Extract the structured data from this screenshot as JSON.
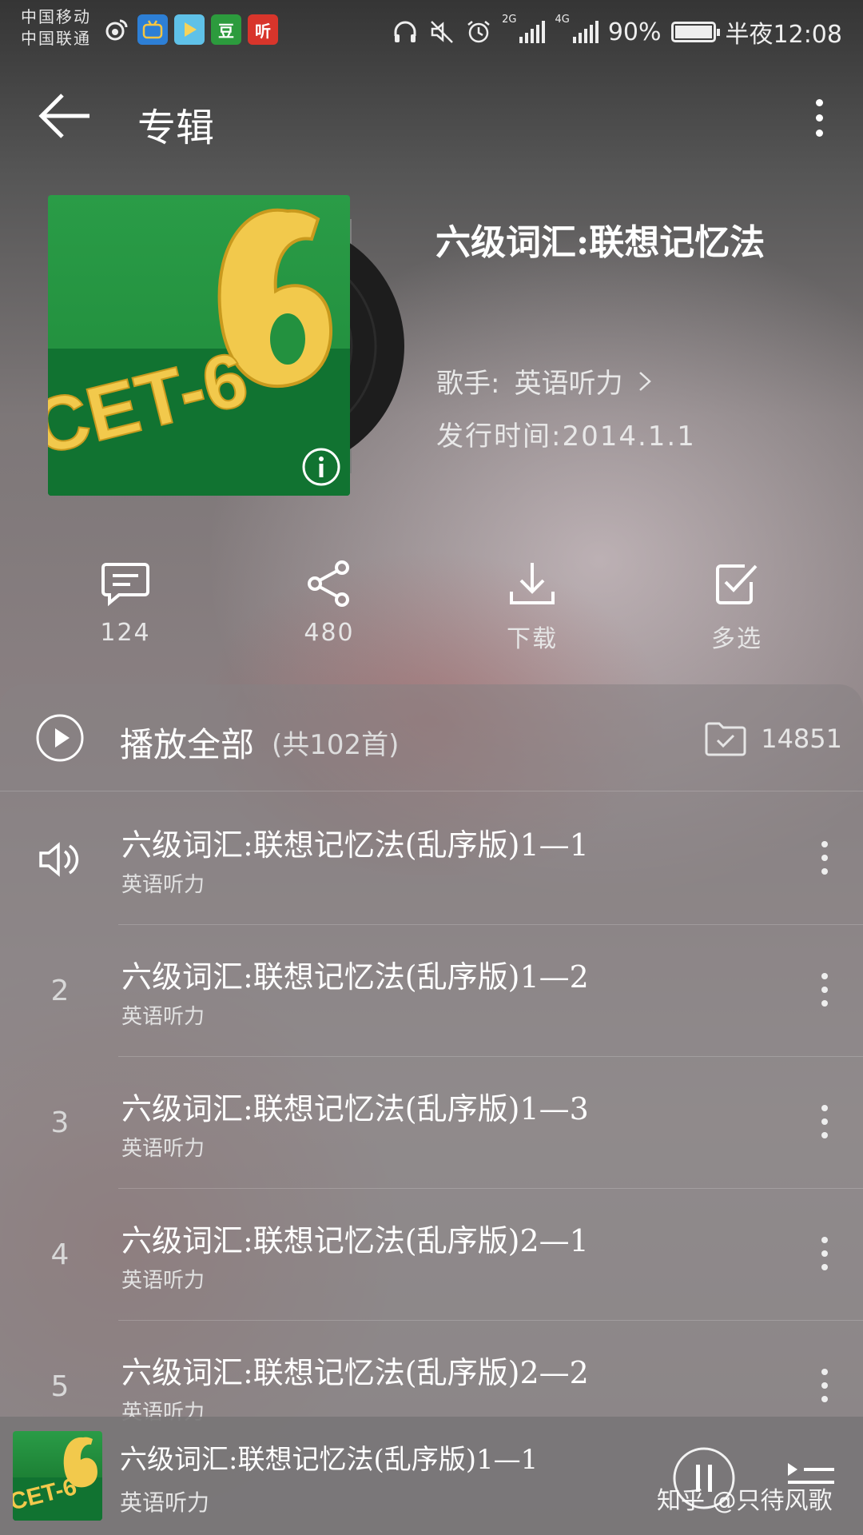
{
  "status_bar": {
    "carrier_1": "中国移动",
    "carrier_2": "中国联通",
    "network_1": "2G",
    "network_2": "4G",
    "battery": "90%",
    "time": "半夜12:08",
    "app_icons": [
      "weibo-icon",
      "bilibili-icon",
      "video-icon",
      "douban-icon",
      "ting-icon"
    ],
    "douban_label": "豆",
    "ting_label": "听"
  },
  "header": {
    "title": "专辑"
  },
  "album": {
    "title": "六级词汇:联想记忆法",
    "cover_text": "CET-6",
    "artist_label": "歌手:",
    "artist": "英语听力",
    "release": "发行时间:2014.1.1"
  },
  "actions": {
    "comments": "124",
    "shares": "480",
    "download": "下载",
    "multi_select": "多选"
  },
  "playlist": {
    "play_all": "播放全部",
    "count": "(共102首)",
    "collect_count": "14851",
    "tracks": [
      {
        "index": "",
        "title": "六级词汇:联想记忆法(乱序版)1—1",
        "artist": "英语听力",
        "playing": true
      },
      {
        "index": "2",
        "title": "六级词汇:联想记忆法(乱序版)1—2",
        "artist": "英语听力",
        "playing": false
      },
      {
        "index": "3",
        "title": "六级词汇:联想记忆法(乱序版)1—3",
        "artist": "英语听力",
        "playing": false
      },
      {
        "index": "4",
        "title": "六级词汇:联想记忆法(乱序版)2—1",
        "artist": "英语听力",
        "playing": false
      },
      {
        "index": "5",
        "title": "六级词汇:联想记忆法(乱序版)2—2",
        "artist": "英语听力",
        "playing": false
      }
    ]
  },
  "mini_player": {
    "title": "六级词汇:联想记忆法(乱序版)1—1",
    "artist": "英语听力"
  },
  "watermark": "知乎 @只待风歌",
  "colors": {
    "cover_green": "#23913f",
    "cover_yellow": "#f2c94c",
    "text": "#ffffff"
  }
}
